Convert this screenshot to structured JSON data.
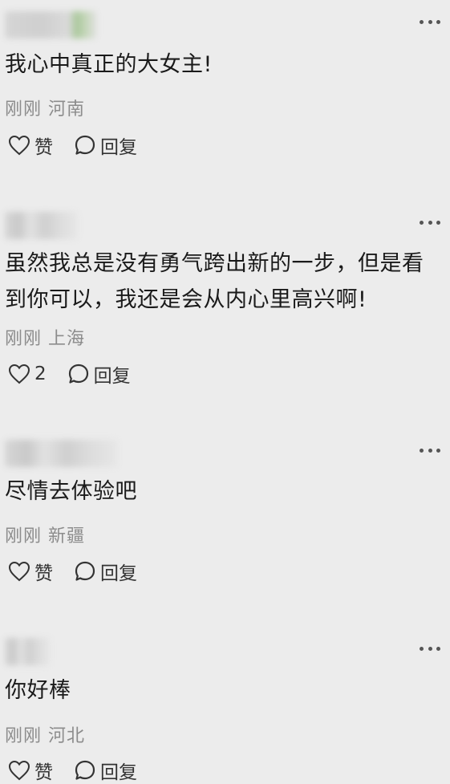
{
  "comments": [
    {
      "text": "我心中真正的大女主!",
      "time": "刚刚",
      "location": "河南",
      "like_label": "赞",
      "reply_label": "回复"
    },
    {
      "text": "虽然我总是没有勇气跨出新的一步，但是看到你可以，我还是会从内心里高兴啊!",
      "time": "刚刚",
      "location": "上海",
      "like_label": "2",
      "reply_label": "回复"
    },
    {
      "text": "尽情去体验吧",
      "time": "刚刚",
      "location": "新疆",
      "like_label": "赞",
      "reply_label": "回复"
    },
    {
      "text": "你好棒",
      "time": "刚刚",
      "location": "河北",
      "like_label": "赞",
      "reply_label": "回复"
    }
  ],
  "icons": {
    "more": "more-options-icon",
    "like": "heart-outline-icon",
    "reply": "speech-bubble-icon"
  }
}
